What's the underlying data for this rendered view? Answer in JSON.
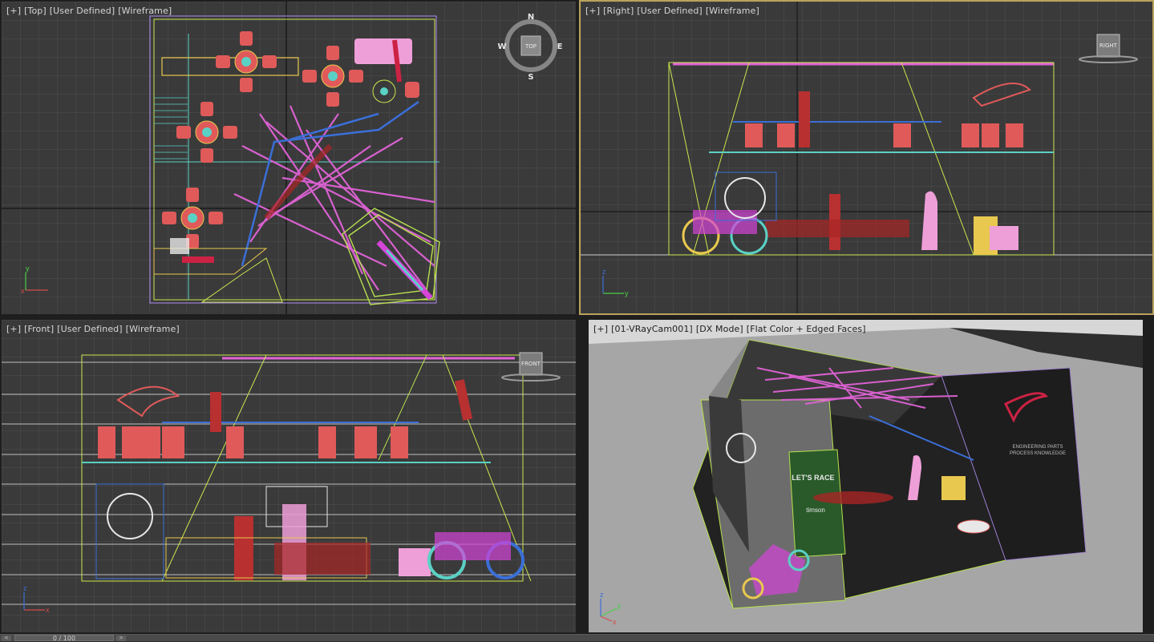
{
  "viewports": {
    "top": {
      "labels": [
        "[+]",
        "[Top]",
        "[User Defined]",
        "[Wireframe]"
      ]
    },
    "right": {
      "labels": [
        "[+]",
        "[Right]",
        "[User Defined]",
        "[Wireframe]"
      ]
    },
    "front": {
      "labels": [
        "[+]",
        "[Front]",
        "[User Defined]",
        "[Wireframe]"
      ]
    },
    "camera": {
      "labels": [
        "[+]",
        "[01-VRayCam001]",
        "[DX Mode]",
        "[Flat Color + Edged Faces]"
      ]
    }
  },
  "viewcube": {
    "top_label": "TOP",
    "right_label": "RIGHT",
    "front_label": "FRONT",
    "compass": {
      "n": "N",
      "s": "S",
      "e": "E",
      "w": "W"
    }
  },
  "axis": {
    "x": "x",
    "y": "y",
    "z": "z"
  },
  "booth_signage": {
    "banner_text": "LET'S RACE",
    "brand": "timson",
    "wall_text_1": "ENGINEERING PARTS",
    "wall_text_2": "PROCESS KNOWLEDGE"
  },
  "time_slider": {
    "value": "0 / 100",
    "prev": "<",
    "next": ">"
  },
  "colors": {
    "viewport_bg": "#3a3a3a",
    "grid": "#555555",
    "active_border": "#b9a25a",
    "furniture_red": "#e05a5a",
    "pink_lines": "#e063d6",
    "outline_green": "#b8e04f",
    "blue": "#3b6fd8"
  }
}
